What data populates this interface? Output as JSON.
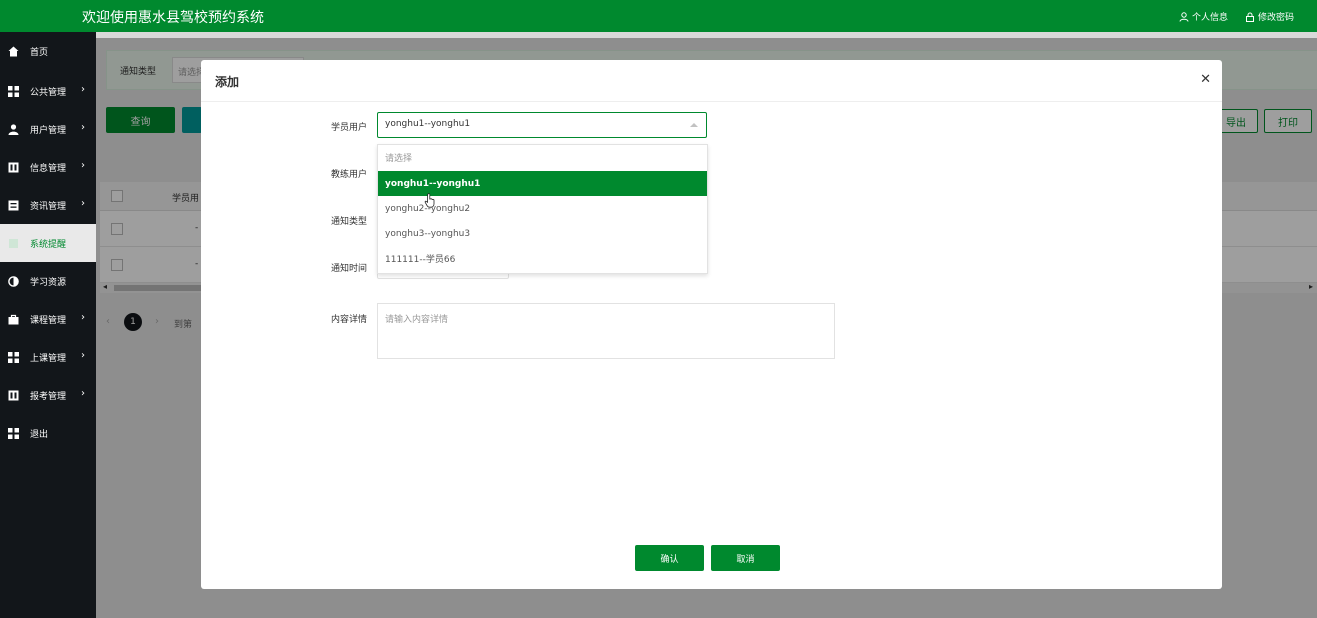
{
  "header": {
    "title": "欢迎使用惠水县驾校预约系统",
    "profile_label": "个人信息",
    "password_label": "修改密码"
  },
  "sidebar": {
    "items": [
      {
        "label": "首页",
        "icon": "home-icon"
      },
      {
        "label": "公共管理",
        "icon": "grid-icon"
      },
      {
        "label": "用户管理",
        "icon": "user-icon"
      },
      {
        "label": "信息管理",
        "icon": "table-icon"
      },
      {
        "label": "资讯管理",
        "icon": "news-icon"
      },
      {
        "label": "系统提醒",
        "icon": "bell-icon",
        "active": true
      },
      {
        "label": "学习资源",
        "icon": "half-circle-icon"
      },
      {
        "label": "课程管理",
        "icon": "bag-icon"
      },
      {
        "label": "上课管理",
        "icon": "grid-icon"
      },
      {
        "label": "报考管理",
        "icon": "table-icon"
      },
      {
        "label": "退出",
        "icon": "grid-icon"
      }
    ]
  },
  "search": {
    "type_label": "通知类型",
    "type_placeholder": "请选择"
  },
  "toolbar": {
    "query_label": "查询",
    "export_label": "导出",
    "print_label": "打印"
  },
  "table": {
    "first_col_header": "学员用",
    "rows": [
      {
        "col1": "-"
      },
      {
        "col1": "-"
      }
    ]
  },
  "pagination": {
    "current": "1",
    "goto_label": "到第"
  },
  "modal": {
    "title": "添加",
    "fields": {
      "student_label": "学员用户",
      "student_value": "yonghu1--yonghu1",
      "coach_label": "教练用户",
      "type_label": "通知类型",
      "time_label": "通知时间",
      "content_label": "内容详情",
      "content_placeholder": "请输入内容详情"
    },
    "dropdown_options": [
      "请选择",
      "yonghu1--yonghu1",
      "yonghu2--yonghu2",
      "yonghu3--yonghu3",
      "111111--学员66"
    ],
    "confirm_label": "确认",
    "cancel_label": "取消"
  },
  "colors": {
    "brand": "#00892e",
    "sidebar_bg": "#12161a"
  }
}
